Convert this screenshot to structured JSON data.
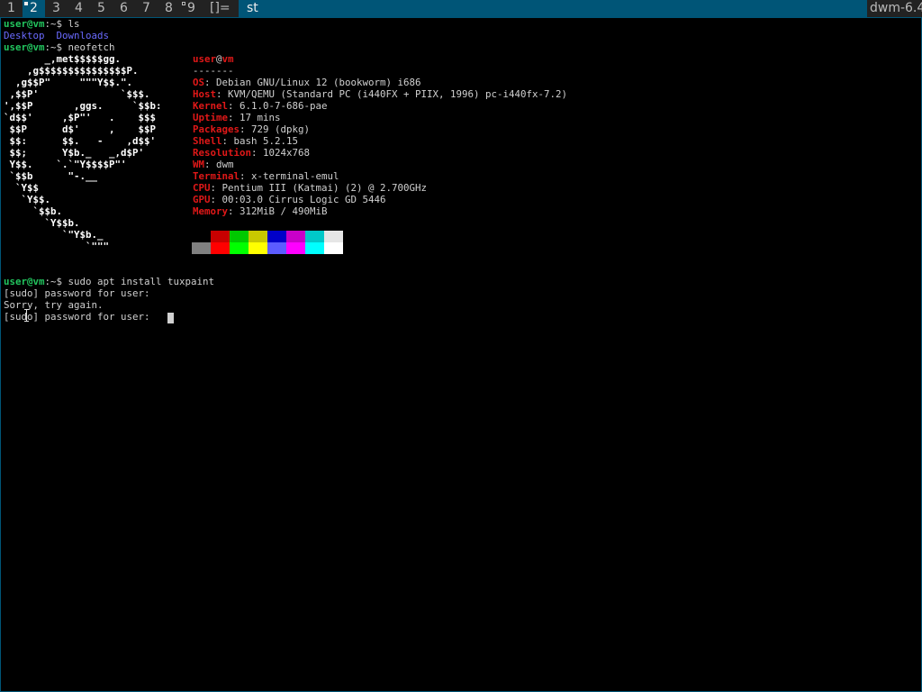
{
  "bar": {
    "tags": [
      "1",
      "2",
      "3",
      "4",
      "5",
      "6",
      "7",
      "8",
      "9"
    ],
    "selected_tag": "2",
    "layout_symbol": "[]=",
    "window_title": "st",
    "status": "dwm-6.4"
  },
  "terminal": {
    "ls_cmd": {
      "user": "user@vm",
      "rest": ":~$ ls"
    },
    "ls_out": {
      "d1": "Desktop",
      "d2": "Downloads"
    },
    "neofetch_cmd": {
      "user": "user@vm",
      "rest": ":~$ neofetch"
    },
    "logo": [
      "       _,met$$$$$gg.",
      "    ,g$$$$$$$$$$$$$$$P.",
      "  ,g$$P\"     \"\"\"Y$$.\".",
      " ,$$P'              `$$$.",
      "',$$P       ,ggs.     `$$b:",
      "`d$$'     ,$P\"'   .    $$$",
      " $$P      d$'     ,    $$P",
      " $$:      $$.   -    ,d$$'",
      " $$;      Y$b._   _,d$P'",
      " Y$$.    `.`\"Y$$$$P\"'",
      " `$$b      \"-.__",
      "  `Y$$",
      "   `Y$$.",
      "     `$$b.",
      "       `Y$$b.",
      "          `\"Y$b._",
      "              `\"\"\""
    ],
    "header": {
      "user": "user",
      "at": "@",
      "host": "vm",
      "sep": "-------"
    },
    "info": [
      {
        "key": "OS",
        "value": ": Debian GNU/Linux 12 (bookworm) i686"
      },
      {
        "key": "Host",
        "value": ": KVM/QEMU (Standard PC (i440FX + PIIX, 1996) pc-i440fx-7.2)"
      },
      {
        "key": "Kernel",
        "value": ": 6.1.0-7-686-pae"
      },
      {
        "key": "Uptime",
        "value": ": 17 mins"
      },
      {
        "key": "Packages",
        "value": ": 729 (dpkg)"
      },
      {
        "key": "Shell",
        "value": ": bash 5.2.15"
      },
      {
        "key": "Resolution",
        "value": ": 1024x768"
      },
      {
        "key": "WM",
        "value": ": dwm"
      },
      {
        "key": "Terminal",
        "value": ": x-terminal-emul"
      },
      {
        "key": "CPU",
        "value": ": Pentium III (Katmai) (2) @ 2.700GHz"
      },
      {
        "key": "GPU",
        "value": ": 00:03.0 Cirrus Logic GD 5446"
      },
      {
        "key": "Memory",
        "value": ": 312MiB / 490MiB"
      }
    ],
    "palette_dark": [
      "#000000",
      "#c80000",
      "#00c800",
      "#c8c800",
      "#0000c8",
      "#c800c8",
      "#00c8c8",
      "#e6e6e6"
    ],
    "palette_bright": [
      "#808080",
      "#ff0000",
      "#00ff00",
      "#ffff00",
      "#5c5cff",
      "#ff00ff",
      "#00ffff",
      "#ffffff"
    ],
    "apt_cmd": {
      "user": "user@vm",
      "rest": ":~$ sudo apt install tuxpaint"
    },
    "sudo_prompt_1": "[sudo] password for user:",
    "sorry": "Sorry, try again.",
    "sudo_prompt_2": "[sudo] password for user:"
  }
}
